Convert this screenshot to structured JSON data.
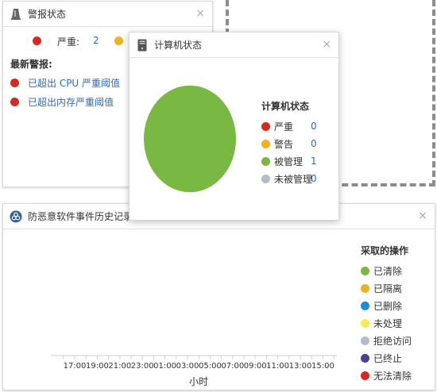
{
  "alarm_panel": {
    "title": "警报状态",
    "close": "×",
    "severity_label": "严重:",
    "severity_count": "2",
    "latest_title": "最新警报:",
    "alarms": [
      {
        "text": "已超出 CPU 严重阈值",
        "color": "#d9281e"
      },
      {
        "text": "已超出内存严重阈值",
        "color": "#d9281e"
      }
    ],
    "colors": {
      "critical": "#d9281e",
      "warning": "#f0b020"
    }
  },
  "history_panel": {
    "title": "防恶意软件事件历史记录",
    "close": "×",
    "legend_title": "采取的操作",
    "legend": [
      {
        "label": "已清除",
        "color": "#78b843"
      },
      {
        "label": "已隔离",
        "color": "#eeb121"
      },
      {
        "label": "已删除",
        "color": "#1a8bd6"
      },
      {
        "label": "未处理",
        "color": "#f3ec54"
      },
      {
        "label": "拒绝访问",
        "color": "#b5bcc8"
      },
      {
        "label": "已终止",
        "color": "#4b3f98"
      },
      {
        "label": "无法清除",
        "color": "#d9281e"
      }
    ]
  },
  "pc_panel": {
    "title": "计算机状态",
    "close": "×",
    "legend_title": "计算机状态"
  },
  "chart_data": [
    {
      "type": "pie",
      "title": "计算机状态",
      "categories": [
        "严重",
        "警告",
        "被管理",
        "未被管理"
      ],
      "values": [
        0,
        0,
        1,
        0
      ],
      "colors": [
        "#d9281e",
        "#eeb121",
        "#78b843",
        "#b5bcc8"
      ]
    },
    {
      "type": "bar",
      "title": "",
      "xlabel": "小时",
      "ylabel": "",
      "categories": [
        "17:00",
        "19:00",
        "21:00",
        "23:00",
        "01:00",
        "03:00",
        "05:00",
        "07:00",
        "09:00",
        "11:00",
        "13:00",
        "15:00"
      ],
      "series": [
        {
          "name": "已清除",
          "values": [
            0,
            0,
            0,
            0,
            0,
            0,
            0,
            0,
            0,
            0,
            0,
            0
          ]
        },
        {
          "name": "已隔离",
          "values": [
            0,
            0,
            0,
            0,
            0,
            0,
            0,
            0,
            0,
            0,
            0,
            0
          ]
        },
        {
          "name": "已删除",
          "values": [
            0,
            0,
            0,
            0,
            0,
            0,
            0,
            0,
            0,
            0,
            0,
            0
          ]
        },
        {
          "name": "未处理",
          "values": [
            0,
            0,
            0,
            0,
            0,
            0,
            0,
            0,
            0,
            0,
            0,
            0
          ]
        },
        {
          "name": "拒绝访问",
          "values": [
            0,
            0,
            0,
            0,
            0,
            0,
            0,
            0,
            0,
            0,
            0,
            0
          ]
        },
        {
          "name": "已终止",
          "values": [
            0,
            0,
            0,
            0,
            0,
            0,
            0,
            0,
            0,
            0,
            0,
            0
          ]
        },
        {
          "name": "无法清除",
          "values": [
            0,
            0,
            0,
            0,
            0,
            0,
            0,
            0,
            0,
            0,
            0,
            0
          ]
        }
      ]
    }
  ]
}
